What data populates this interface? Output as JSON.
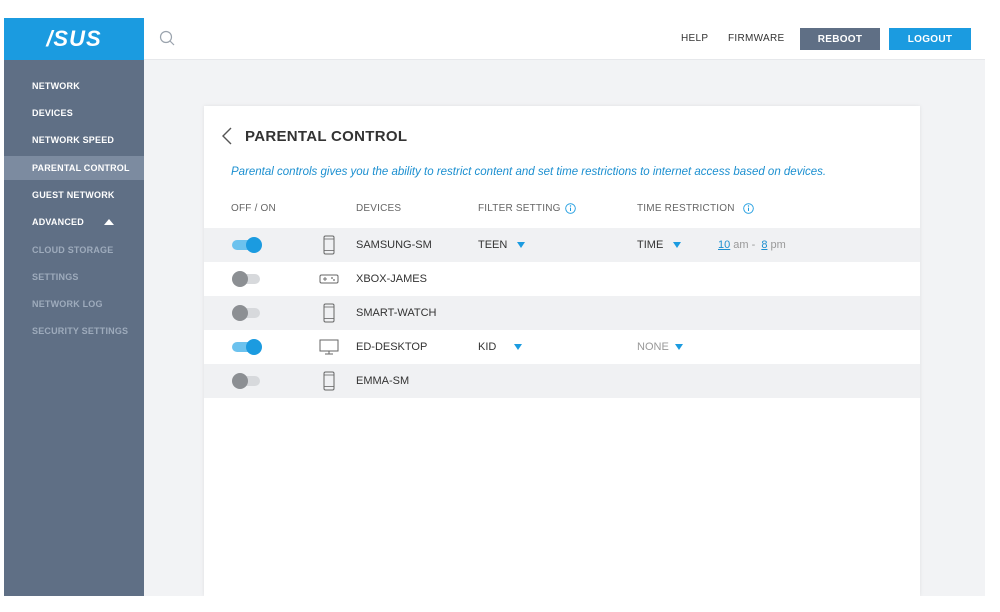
{
  "brand": {
    "logo": "/SUS"
  },
  "topbar": {
    "help": "HELP",
    "firmware": "FIRMWARE",
    "reboot": "REBOOT",
    "logout": "LOGOUT"
  },
  "sidebar": {
    "items": [
      {
        "label": "NETWORK"
      },
      {
        "label": "DEVICES"
      },
      {
        "label": "NETWORK SPEED"
      },
      {
        "label": "PARENTAL CONTROL"
      },
      {
        "label": "GUEST NETWORK"
      },
      {
        "label": "ADVANCED"
      },
      {
        "label": "CLOUD STORAGE"
      },
      {
        "label": "SETTINGS"
      },
      {
        "label": "NETWORK LOG"
      },
      {
        "label": "SECURITY SETTINGS"
      }
    ]
  },
  "page": {
    "title": "PARENTAL CONTROL",
    "description": "Parental controls gives you the ability to restrict content and set time restrictions to internet access based on devices."
  },
  "table": {
    "headers": {
      "toggle": "OFF / ON",
      "devices": "DEVICES",
      "filter": "FILTER SETTING",
      "time": "TIME RESTRICTION"
    },
    "rows": [
      {
        "enabled": true,
        "icon": "phone-icon",
        "device": "SAMSUNG-SM",
        "filter": "TEEN",
        "time": "TIME",
        "from": "10",
        "from_unit": "am",
        "sep": "-",
        "to": "8",
        "to_unit": "pm"
      },
      {
        "enabled": false,
        "icon": "gamepad-icon",
        "device": "XBOX-JAMES"
      },
      {
        "enabled": false,
        "icon": "watch-icon",
        "device": "SMART-WATCH"
      },
      {
        "enabled": true,
        "icon": "monitor-icon",
        "device": "ED-DESKTOP",
        "filter": "KID",
        "time": "NONE"
      },
      {
        "enabled": false,
        "icon": "phone-icon",
        "device": "EMMA-SM"
      }
    ]
  },
  "colors": {
    "accent": "#1b9be0",
    "sidebar": "#5f6f85",
    "sidebar_active": "#7c8ba0",
    "reboot": "#5f6f85"
  }
}
